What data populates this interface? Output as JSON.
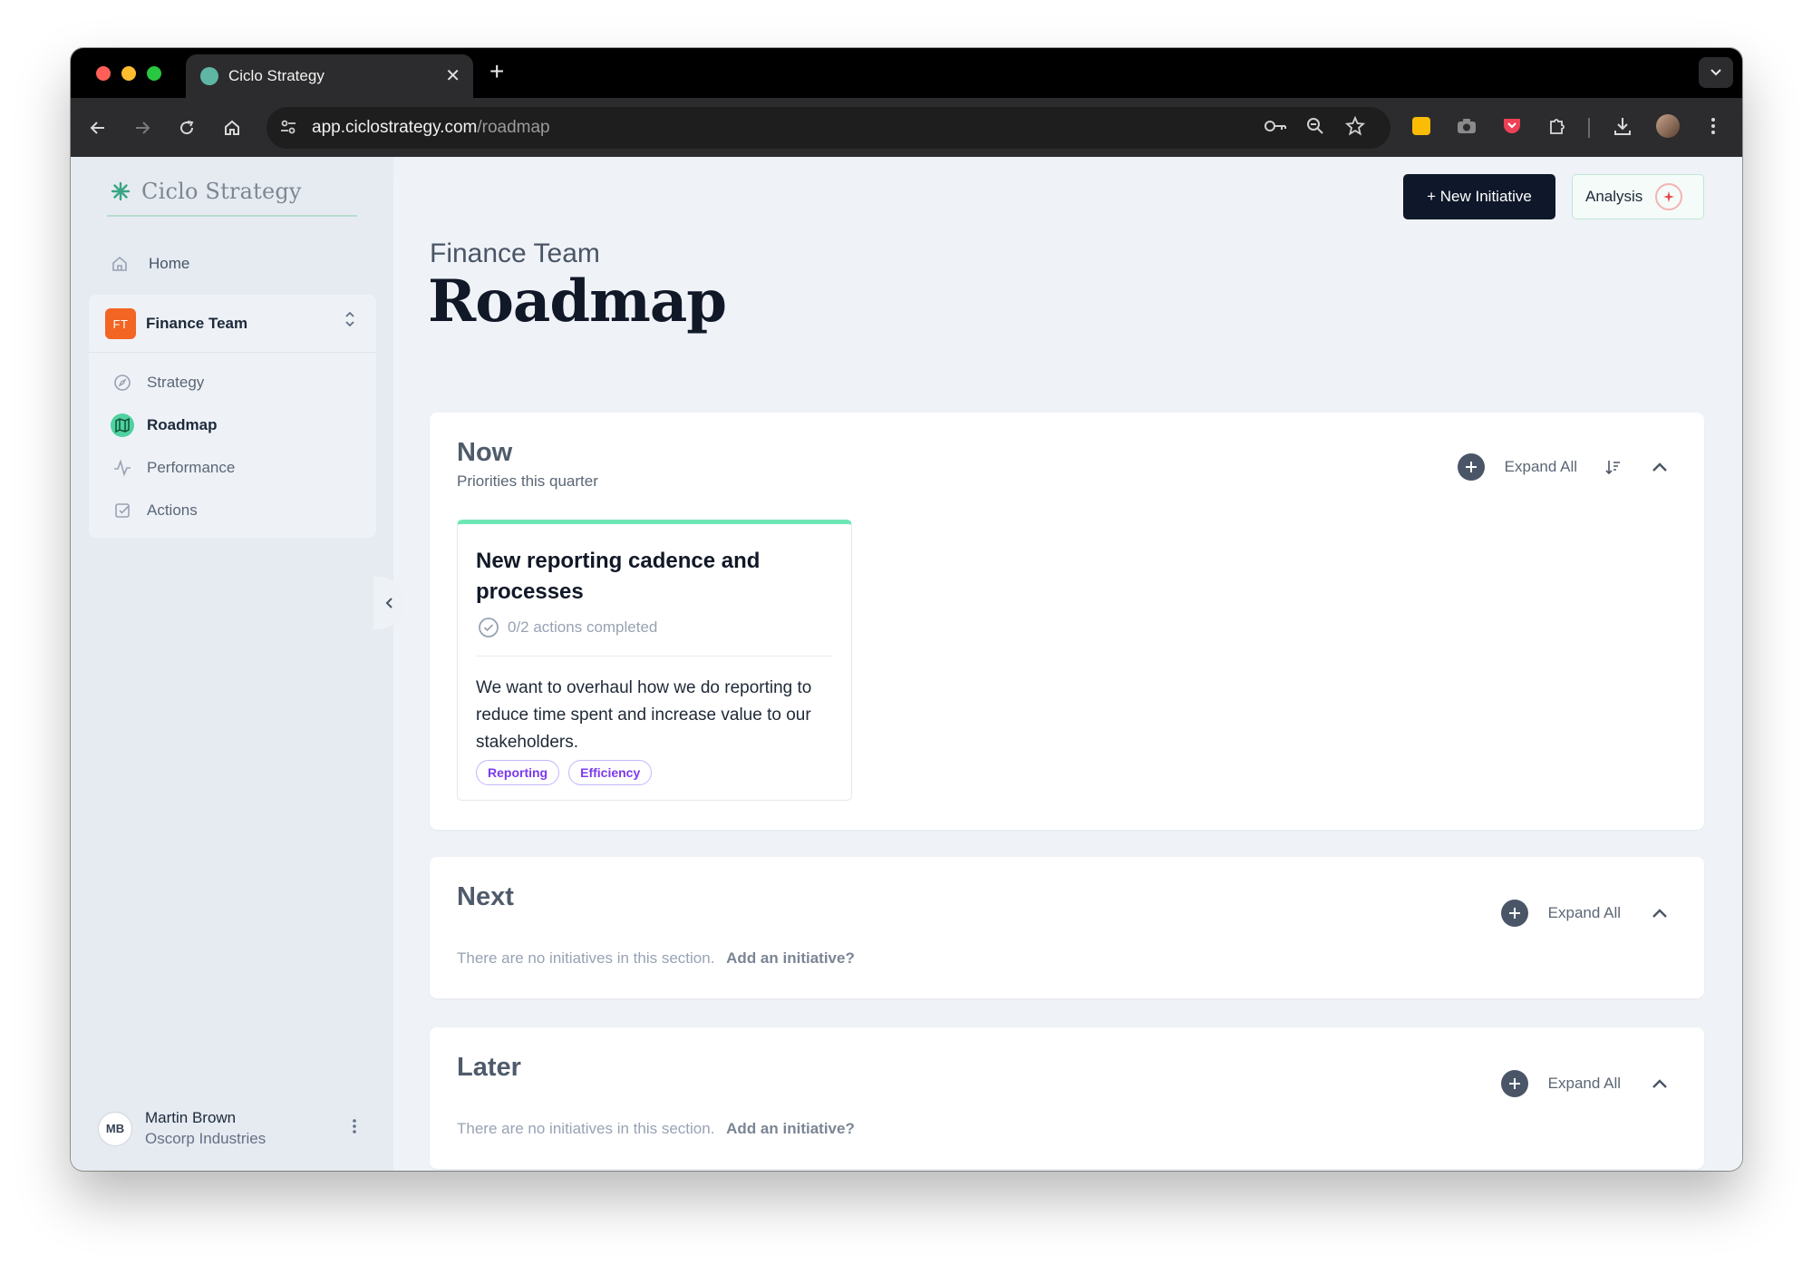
{
  "browser": {
    "tab_title": "Ciclo Strategy",
    "tab_close": "✕",
    "new_tab": "+",
    "url_host": "app.ciclostrategy.com",
    "url_path": "/roadmap"
  },
  "sidebar": {
    "brand": "Ciclo Strategy",
    "home_label": "Home",
    "team": {
      "initials": "FT",
      "name": "Finance Team"
    },
    "items": [
      {
        "label": "Strategy",
        "icon": "compass-icon"
      },
      {
        "label": "Roadmap",
        "icon": "map-icon",
        "active": true
      },
      {
        "label": "Performance",
        "icon": "activity-icon"
      },
      {
        "label": "Actions",
        "icon": "checkbox-icon"
      }
    ],
    "user": {
      "initials": "MB",
      "name": "Martin Brown",
      "org": "Oscorp Industries"
    }
  },
  "header": {
    "new_initiative_label": "+ New Initiative",
    "analysis_label": "Analysis"
  },
  "page": {
    "subtitle": "Finance Team",
    "title": "Roadmap"
  },
  "sections": {
    "now": {
      "title": "Now",
      "subtitle": "Priorities this quarter",
      "expand_label": "Expand All",
      "card": {
        "title": "New reporting cadence and processes",
        "progress": "0/2 actions completed",
        "description": "We want to overhaul how we do reporting to reduce time spent and increase value to our stakeholders.",
        "tags": [
          "Reporting",
          "Efficiency"
        ]
      }
    },
    "next": {
      "title": "Next",
      "expand_label": "Expand All",
      "empty_text": "There are no initiatives in this section.",
      "empty_link": "Add an initiative?"
    },
    "later": {
      "title": "Later",
      "expand_label": "Expand All",
      "empty_text": "There are no initiatives in this section.",
      "empty_link": "Add an initiative?"
    }
  },
  "colors": {
    "accent_green": "#4fd1a1",
    "team_badge": "#f26522",
    "tag_purple": "#7c3aed",
    "primary_button": "#0f172a"
  }
}
